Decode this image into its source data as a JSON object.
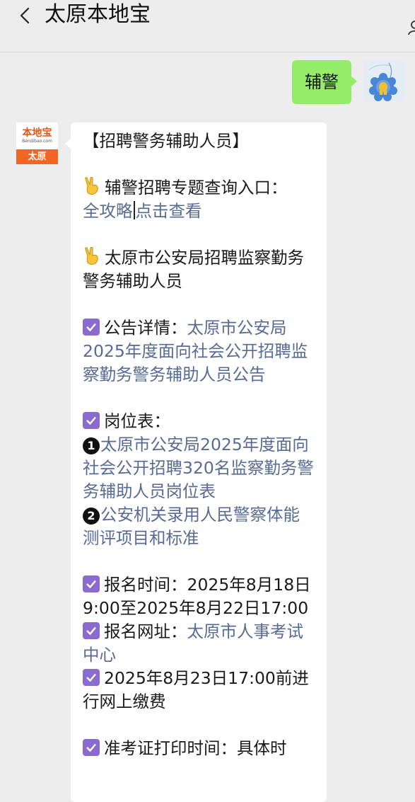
{
  "header": {
    "title": "太原本地宝"
  },
  "outgoing": {
    "text": "辅警"
  },
  "incoming": {
    "avatar": {
      "logo_cn": "本地宝",
      "logo_en": "Bendibao.com",
      "city": "太原"
    },
    "heading": "【招聘警务辅助人员】",
    "entry": {
      "label": "辅警招聘专题查询入口：",
      "link_a": "全攻略",
      "link_b": "点击查看"
    },
    "subject": "太原市公安局招聘监察勤务警务辅助人员",
    "notice": {
      "label": "公告详情：",
      "link": "太原市公安局2025年度面向社会公开招聘监察勤务警务辅助人员公告"
    },
    "positions": {
      "label": "岗位表：",
      "item1": "太原市公安局2025年度面向社会公开招聘320名监察勤务警务辅助人员岗位表",
      "item2": "公安机关录用人民警察体能测评项目和标准",
      "num1": "1",
      "num2": "2"
    },
    "signup_time": "报名时间：2025年8月18日9:00至2025年8月22日17:00",
    "signup_site": {
      "label": "报名网址：",
      "link": "太原市人事考试中心"
    },
    "payment": "2025年8月23日17:00前进行网上缴费",
    "admit_card": "准考证打印时间：具体时"
  }
}
